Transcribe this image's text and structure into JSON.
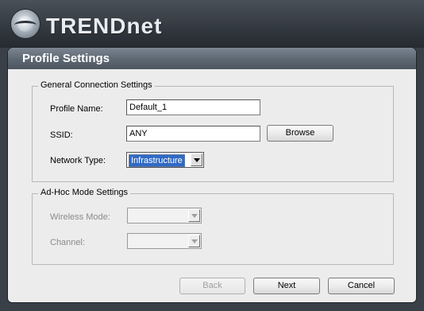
{
  "header": {
    "brand": "TRENDnet",
    "logo_icon": "trendnet-logo-icon"
  },
  "panel": {
    "title": "Profile Settings"
  },
  "general": {
    "legend": "General Connection Settings",
    "profile_name_label": "Profile Name:",
    "profile_name_value": "Default_1",
    "ssid_label": "SSID:",
    "ssid_value": "ANY",
    "browse_label": "Browse",
    "network_type_label": "Network Type:",
    "network_type_value": "Infrastructure"
  },
  "adhoc": {
    "legend": "Ad-Hoc Mode Settings",
    "wireless_mode_label": "Wireless Mode:",
    "wireless_mode_value": "",
    "channel_label": "Channel:",
    "channel_value": ""
  },
  "footer": {
    "back_label": "Back",
    "next_label": "Next",
    "cancel_label": "Cancel"
  }
}
